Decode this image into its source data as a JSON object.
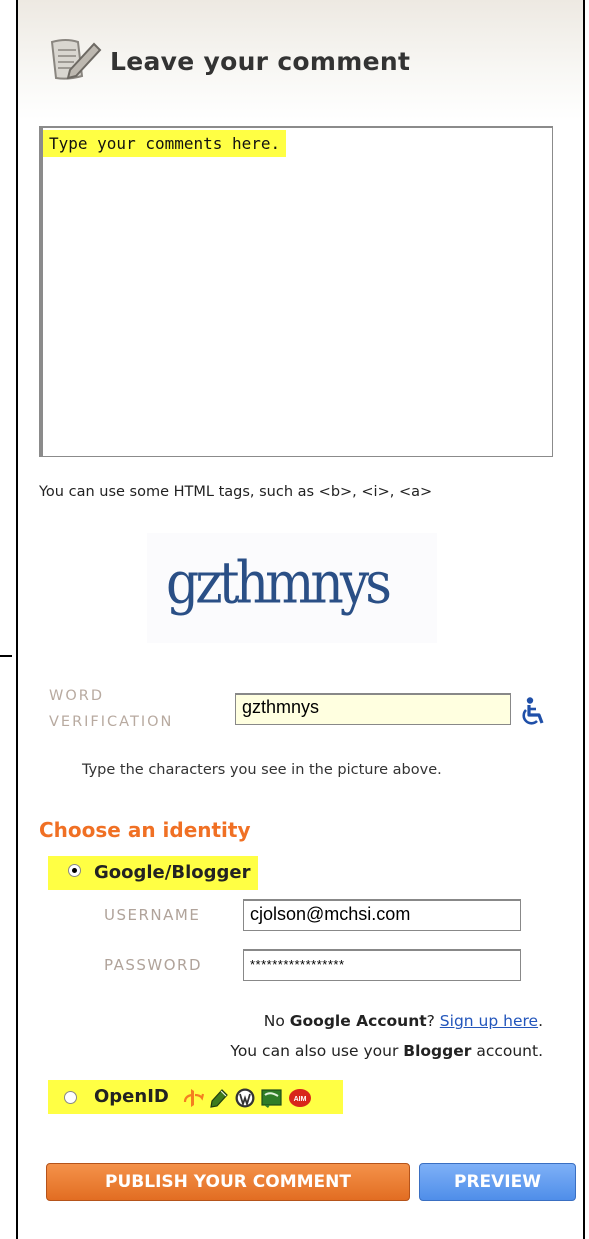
{
  "header": {
    "title": "Leave your comment",
    "icon": "note-pencil-icon"
  },
  "comment": {
    "placeholder": "Type your comments here.",
    "html_hint": "You can use some HTML tags, such as <b>, <i>, <a>"
  },
  "captcha": {
    "text": "gzthmnys"
  },
  "word_verification": {
    "label_line1": "WORD",
    "label_line2": "VERIFICATION",
    "value": "gzthmnys",
    "help": "Type the characters you see in the picture above.",
    "accessibility_icon": "wheelchair-icon"
  },
  "identity": {
    "heading": "Choose an identity",
    "google": {
      "label": "Google/Blogger",
      "selected": true,
      "username_label": "USERNAME",
      "username_value": "cjolson@mchsi.com",
      "password_label": "PASSWORD",
      "password_value": "*****************",
      "no_account_prefix": "No ",
      "no_account_bold": "Google Account",
      "no_account_mid": "? ",
      "signup_link": "Sign up here",
      "no_account_suffix": ".",
      "also_prefix": "You can also use your ",
      "also_bold": "Blogger",
      "also_suffix": " account."
    },
    "openid": {
      "label": "OpenID",
      "selected": false,
      "providers": [
        "openid-icon",
        "livejournal-pencil-icon",
        "wordpress-icon",
        "typepad-icon",
        "aim-icon"
      ]
    }
  },
  "buttons": {
    "publish": "PUBLISH YOUR COMMENT",
    "preview": "PREVIEW"
  },
  "colors": {
    "accent_orange": "#f07024",
    "preview_blue": "#4f8ee9",
    "highlight": "#ffff44"
  }
}
